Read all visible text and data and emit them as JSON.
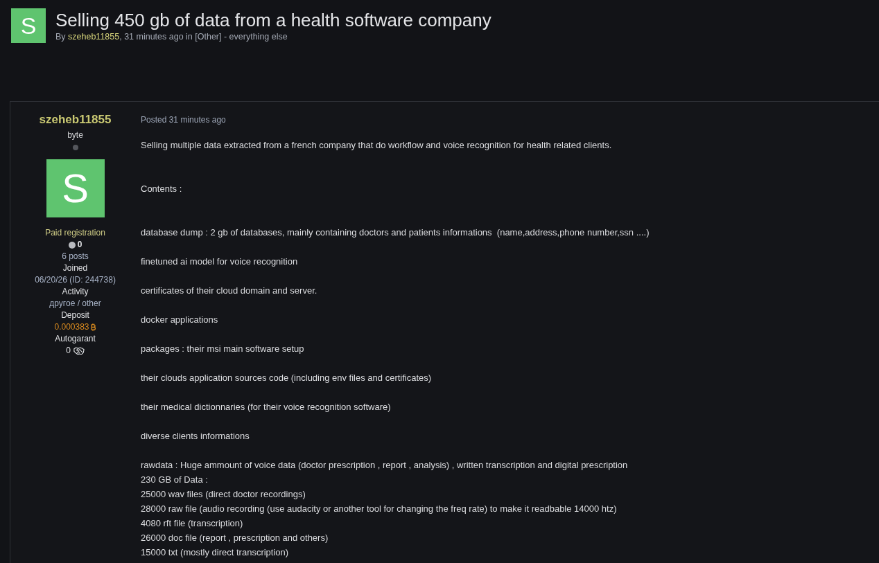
{
  "topic": {
    "avatar_letter": "S",
    "title": "Selling 450 gb of data from a health software company",
    "byline": {
      "prefix": "By",
      "author": "szeheb11855",
      "suffix": ", 31 minutes ago in [Other] - everything else"
    }
  },
  "post": {
    "author": {
      "name": "szeheb11855",
      "rank": "byte",
      "online": false,
      "avatar_letter": "S",
      "group": "Paid registration",
      "reputation": "0",
      "posts": "6 posts",
      "fields": [
        {
          "label": "Joined",
          "value": "06/20/26 (ID: 244738)",
          "kind": "plain"
        },
        {
          "label": "Activity",
          "value": "другое / other",
          "kind": "plain"
        },
        {
          "label": "Deposit",
          "value": "0.000383",
          "kind": "bitcoin"
        },
        {
          "label": "Autogarant",
          "value": "0",
          "kind": "deals"
        }
      ]
    },
    "posted": "Posted 31 minutes ago",
    "body": [
      {
        "kind": "lead",
        "lines": [
          "Selling multiple data extracted from a french company that do workflow and voice recognition for health related clients."
        ]
      },
      {
        "kind": "lead",
        "lines": [
          "Contents :"
        ]
      },
      {
        "kind": "item",
        "lines": [
          "database dump : 2 gb of databases, mainly containing doctors and patients informations  (name,address,phone number,ssn ....)"
        ]
      },
      {
        "kind": "item",
        "lines": [
          "finetuned ai model for voice recognition"
        ]
      },
      {
        "kind": "item",
        "lines": [
          "certificates of their cloud domain and server."
        ]
      },
      {
        "kind": "item",
        "lines": [
          "docker applications"
        ]
      },
      {
        "kind": "item",
        "lines": [
          "packages : their msi main software setup"
        ]
      },
      {
        "kind": "item",
        "lines": [
          "their clouds application sources code (including env files and certificates)"
        ]
      },
      {
        "kind": "item",
        "lines": [
          "their medical dictionnaries (for their voice recognition software)"
        ]
      },
      {
        "kind": "item",
        "lines": [
          "diverse clients informations"
        ]
      },
      {
        "kind": "item",
        "lines": [
          "rawdata : Huge ammount of voice data (doctor prescription , report , analysis) , written transcription and digital prescription",
          "230 GB of Data :",
          "25000 wav files (direct doctor recordings)",
          "28000 raw file (audio recording (use audacity or another tool for changing the freq rate) to make it readbable 14000 htz)",
          "4080 rft file (transcription)",
          "26000 doc file (report , prescription and others)",
          "15000 txt (mostly direct transcription)"
        ]
      }
    ]
  }
}
